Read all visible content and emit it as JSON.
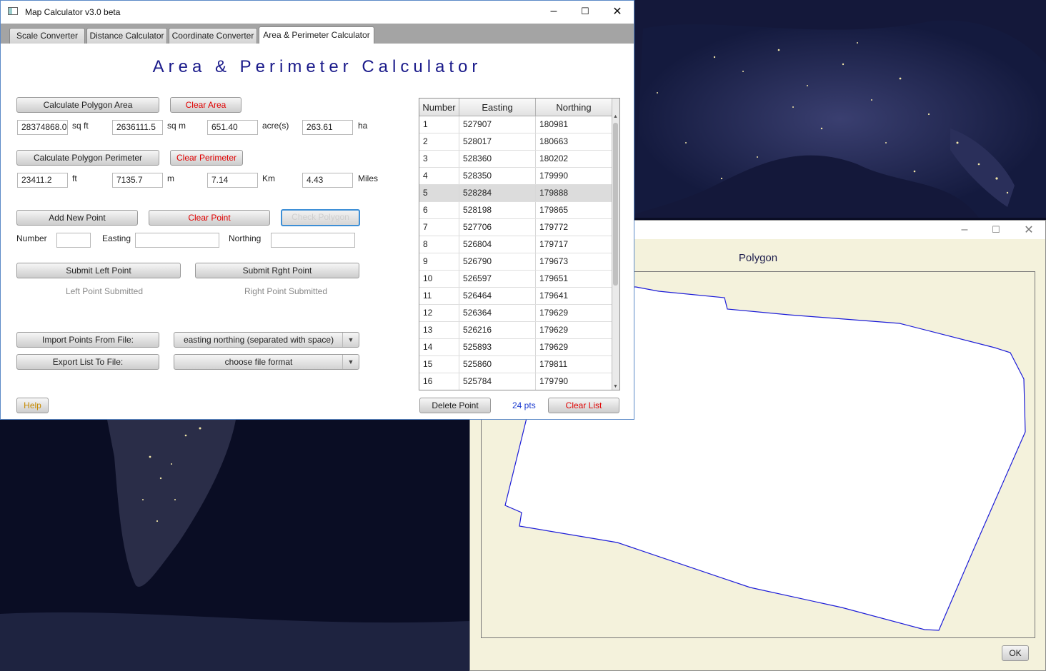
{
  "main_window": {
    "title": "Map Calculator v3.0 beta",
    "tabs": [
      {
        "label": "Scale Converter"
      },
      {
        "label": "Distance Calculator"
      },
      {
        "label": "Coordinate Converter"
      },
      {
        "label": "Area & Perimeter  Calculator",
        "active": true
      }
    ],
    "heading": "Area & Perimeter  Calculator",
    "area": {
      "calc_button": "Calculate Polygon Area",
      "clear_button": "Clear Area",
      "sqft_value": "28374868.0",
      "sqft_unit": "sq ft",
      "sqm_value": "2636111.5",
      "sqm_unit": "sq m",
      "acre_value": "651.40",
      "acre_unit": "acre(s)",
      "ha_value": "263.61",
      "ha_unit": "ha"
    },
    "perimeter": {
      "calc_button": "Calculate Polygon Perimeter",
      "clear_button": "Clear Perimeter",
      "ft_value": "23411.2",
      "ft_unit": "ft",
      "m_value": "7135.7",
      "m_unit": "m",
      "km_value": "7.14",
      "km_unit": "Km",
      "miles_value": "4.43",
      "miles_unit": "Miles"
    },
    "point_entry": {
      "add_button": "Add New Point",
      "clear_button": "Clear Point",
      "check_button": "Check Polygon",
      "number_label": "Number",
      "number_value": "",
      "easting_label": "Easting",
      "easting_value": "",
      "northing_label": "Northing",
      "northing_value": "",
      "submit_left_button": "Submit Left Point",
      "submit_right_button": "Submit Rght Point",
      "left_status": "Left Point Submitted",
      "right_status": "Right Point Submitted"
    },
    "file_io": {
      "import_button": "Import Points From File:",
      "import_format": "easting northing (separated with space)",
      "export_button": "Export List To File:",
      "export_format": "choose file format"
    },
    "help_button": "Help",
    "table": {
      "columns": [
        "Number",
        "Easting",
        "Northing"
      ],
      "selected_row": 5,
      "rows": [
        [
          "1",
          "527907",
          "180981"
        ],
        [
          "2",
          "528017",
          "180663"
        ],
        [
          "3",
          "528360",
          "180202"
        ],
        [
          "4",
          "528350",
          "179990"
        ],
        [
          "5",
          "528284",
          "179888"
        ],
        [
          "6",
          "528198",
          "179865"
        ],
        [
          "7",
          "527706",
          "179772"
        ],
        [
          "8",
          "526804",
          "179717"
        ],
        [
          "9",
          "526790",
          "179673"
        ],
        [
          "10",
          "526597",
          "179651"
        ],
        [
          "11",
          "526464",
          "179641"
        ],
        [
          "12",
          "526364",
          "179629"
        ],
        [
          "13",
          "526216",
          "179629"
        ],
        [
          "14",
          "525893",
          "179629"
        ],
        [
          "15",
          "525860",
          "179811"
        ],
        [
          "16",
          "525784",
          "179790"
        ]
      ],
      "scroll_position": 0.0
    },
    "delete_button": "Delete Point",
    "point_count": "24 pts",
    "clear_list_button": "Clear List"
  },
  "polygon_window": {
    "title": "Polygon",
    "ok_button": "OK",
    "outline_color": "#1c1cd8"
  },
  "colors": {
    "heading": "#1a1a8a",
    "clear_text": "#e00000",
    "count_text": "#1a3ad0",
    "help_text": "#c68a00"
  }
}
